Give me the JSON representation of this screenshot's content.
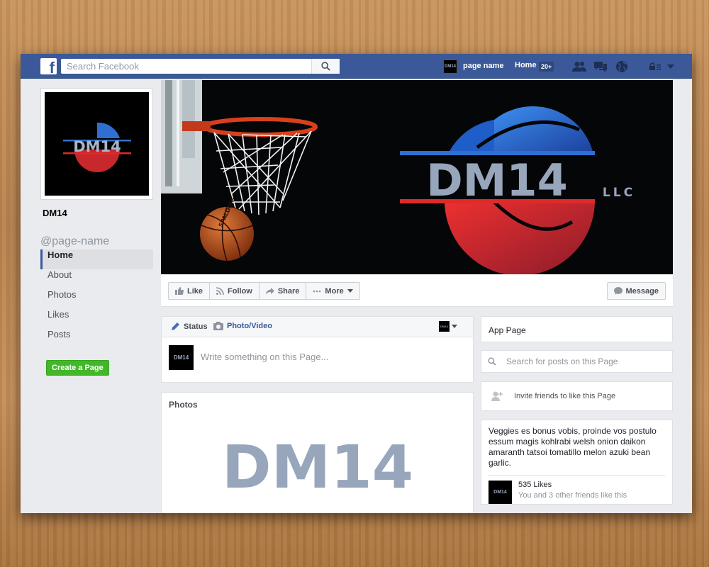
{
  "topbar": {
    "logo": "f",
    "search_placeholder": "Search Facebook",
    "profile_avatar_text": "DM14",
    "profile_name": "page name",
    "home_label": "Home",
    "home_count": "20+"
  },
  "sidebar": {
    "profile_logo_text": "DM14",
    "page_title": "DM14",
    "page_handle": "@page-name",
    "items": [
      {
        "label": "Home",
        "active": true
      },
      {
        "label": "About"
      },
      {
        "label": "Photos"
      },
      {
        "label": "Likes"
      },
      {
        "label": "Posts"
      }
    ],
    "create_page_label": "Create a Page"
  },
  "cover": {
    "brand_text": "DM14",
    "brand_suffix": "LLC",
    "ball_text": "SPALDING"
  },
  "actions": {
    "like": "Like",
    "follow": "Follow",
    "share": "Share",
    "more": "More",
    "message": "Message"
  },
  "composer": {
    "tab_status": "Status",
    "tab_photo": "Photo/Video",
    "avatar_text": "DM14",
    "placeholder": "Write something on this Page..."
  },
  "photos": {
    "title": "Photos",
    "image_text": "DM14"
  },
  "right": {
    "app_page": "App Page",
    "search_placeholder": "Search for posts on this Page",
    "invite_label": "Invite friends to like this Page",
    "about_text": "Veggies es bonus vobis, proinde vos postulo essum magis kohlrabi welsh onion daikon amaranth tatsoi tomatillo melon azuki bean garlic.",
    "likes_avatar_text": "DM14",
    "likes_count": "535 Likes",
    "likes_friends": "You and 3 other friends like this"
  },
  "colors": {
    "facebook_blue": "#3b5998",
    "brand_silver": "#98a6bc",
    "brand_red": "#e02a2a",
    "brand_blue": "#2f6fd1",
    "create_green": "#42b72a"
  },
  "icons": [
    "facebook-logo-icon",
    "search-icon",
    "friends-icon",
    "messages-icon",
    "globe-icon",
    "lock-menu-icon",
    "chevron-down-icon",
    "like-icon",
    "follow-icon",
    "share-icon",
    "more-icon",
    "message-icon",
    "pencil-icon",
    "camera-icon",
    "add-friend-icon"
  ]
}
